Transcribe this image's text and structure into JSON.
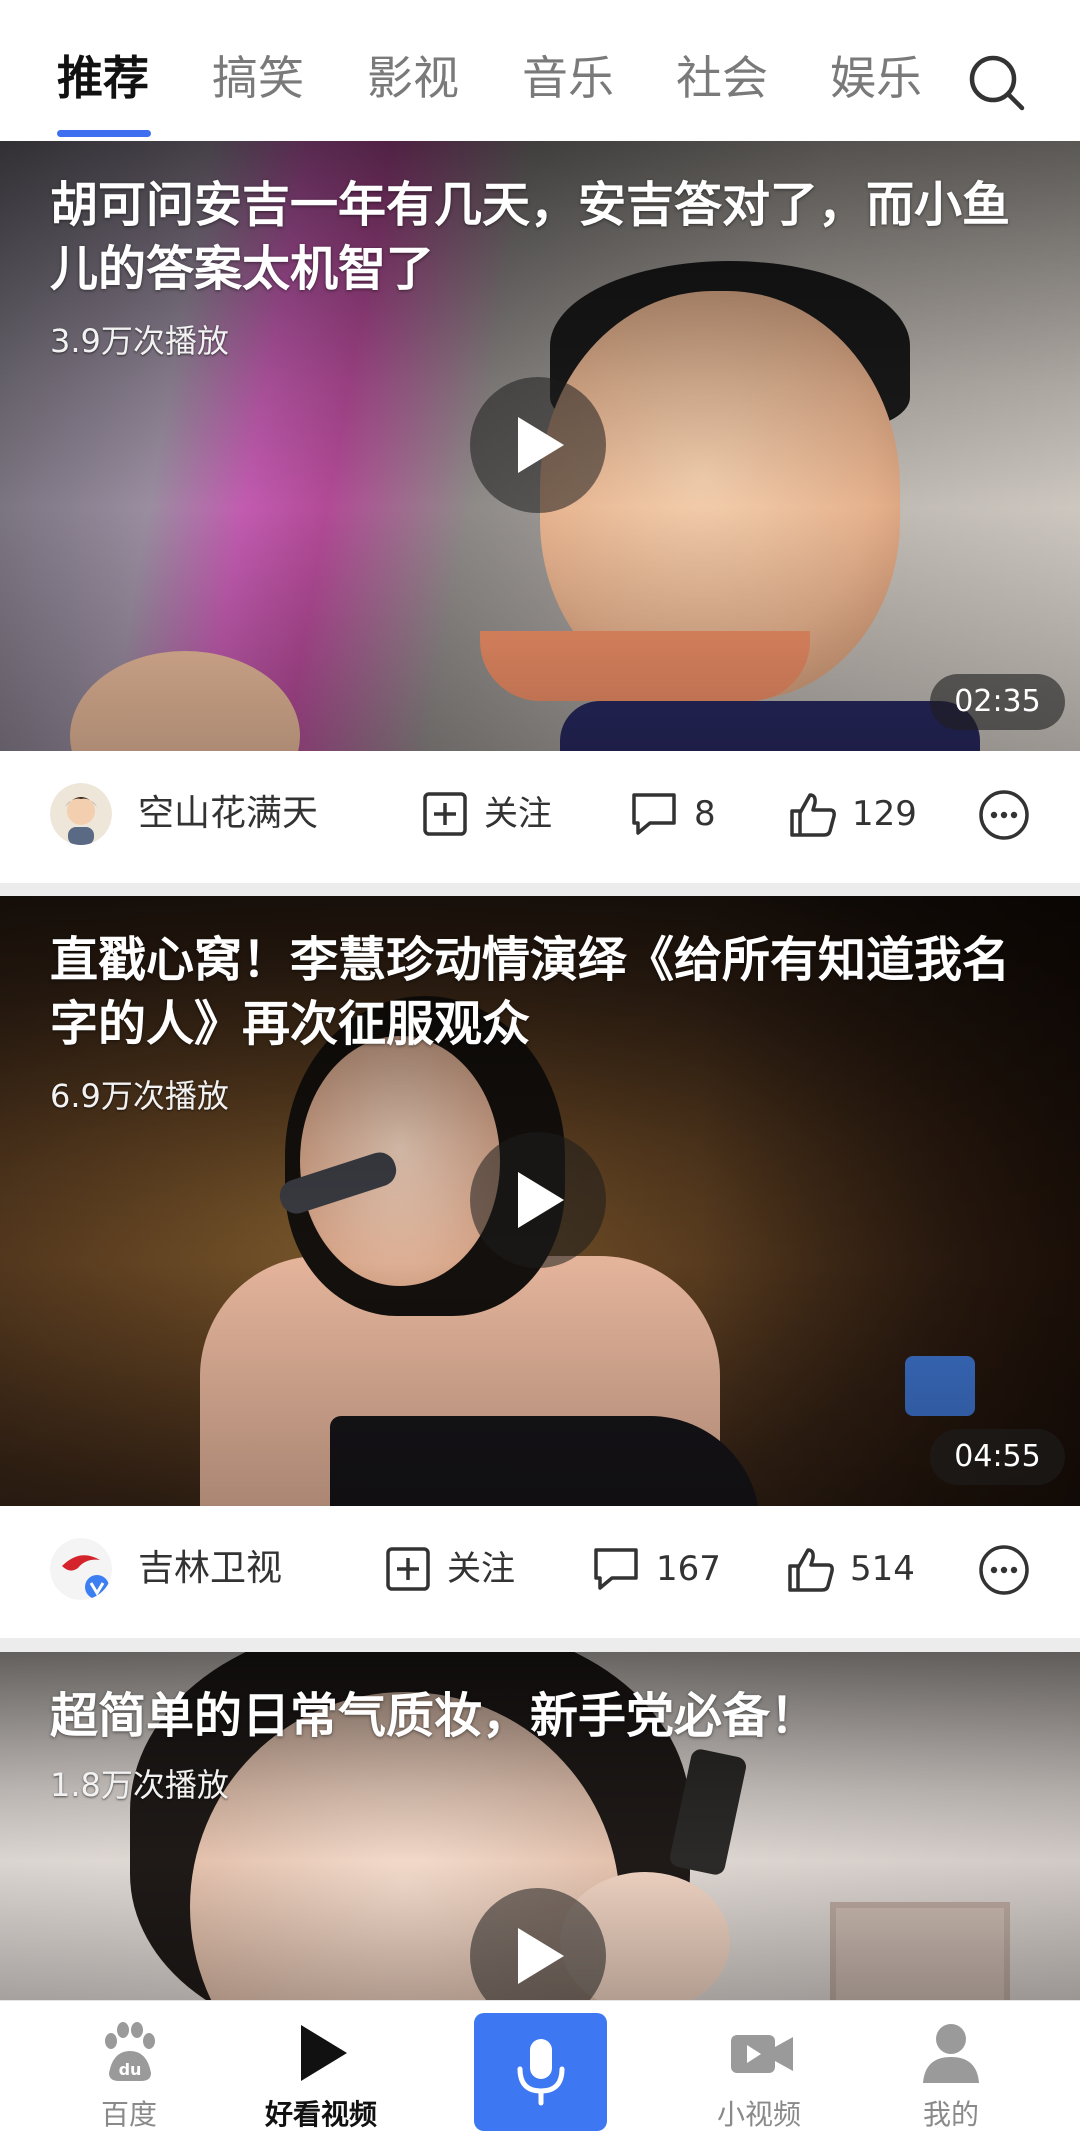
{
  "tabs": [
    {
      "label": "推荐",
      "active": true
    },
    {
      "label": "搞笑",
      "active": false
    },
    {
      "label": "影视",
      "active": false
    },
    {
      "label": "音乐",
      "active": false
    },
    {
      "label": "社会",
      "active": false
    },
    {
      "label": "娱乐",
      "active": false
    }
  ],
  "search_icon": "search-icon",
  "accent_color": "#3e6ff0",
  "feed": [
    {
      "title": "胡可问安吉一年有几天，安吉答对了，而小鱼儿的答案太机智了",
      "plays": "3.9万次播放",
      "duration": "02:35",
      "author": "空山花满天",
      "follow_label": "关注",
      "comments": "8",
      "likes": "129"
    },
    {
      "title": "直戳心窝！李慧珍动情演绎《给所有知道我名字的人》再次征服观众",
      "plays": "6.9万次播放",
      "duration": "04:55",
      "author": "吉林卫视",
      "follow_label": "关注",
      "comments": "167",
      "likes": "514"
    },
    {
      "title": "超简单的日常气质妆，新手党必备！",
      "plays": "1.8万次播放"
    }
  ],
  "bottom_nav": [
    {
      "label": "百度",
      "icon": "baidu-paw-icon",
      "active": false
    },
    {
      "label": "好看视频",
      "icon": "play-icon",
      "active": true
    },
    {
      "label": "",
      "icon": "microphone-icon",
      "active": false
    },
    {
      "label": "小视频",
      "icon": "video-camera-icon",
      "active": false
    },
    {
      "label": "我的",
      "icon": "user-icon",
      "active": false
    }
  ],
  "mic_color": "#3d78f2"
}
